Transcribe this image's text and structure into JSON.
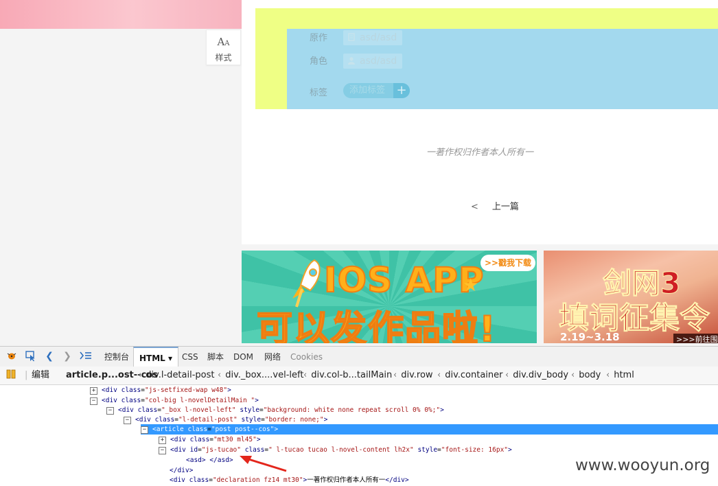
{
  "style_button": {
    "aa_big": "A",
    "aa_small": "A",
    "label": "样式"
  },
  "form": {
    "original": {
      "label": "原作",
      "value": "asd/asd"
    },
    "role": {
      "label": "角色",
      "value": "asd/asd"
    },
    "tags": {
      "label": "标签",
      "button": "添加标签",
      "plus": "+"
    }
  },
  "declaration": "一著作权归作者本人所有一",
  "nav": {
    "prev_arrow": "<",
    "prev_label": "上一篇"
  },
  "ads": {
    "ad1": {
      "title": "IOS APP",
      "subtitle": "可以发作品啦!",
      "bubble": ">>戳我下载"
    },
    "ad2": {
      "title": "剑网3",
      "subtitle": "填词征集令",
      "date": "2.19~3.18",
      "link": ">>>前往围观"
    }
  },
  "devtools": {
    "tabs": [
      "控制台",
      "HTML",
      "CSS",
      "脚本",
      "DOM",
      "网络",
      "Cookies"
    ],
    "edit_label": "编辑",
    "breadcrumbs": [
      "article.p...ost--cos",
      "div.l-detail-post",
      "div._box....vel-left",
      "div.col-b...tailMain",
      "div.row",
      "div.container",
      "div.div_body",
      "body",
      "html"
    ],
    "tree": [
      {
        "toggle": "+",
        "parts": [
          [
            "tg",
            "<div  "
          ],
          [
            "an",
            "class"
          ],
          [
            "tx",
            "="
          ],
          [
            "av",
            "\"js-setfixed-wap w48\""
          ],
          [
            "tg",
            ">"
          ]
        ]
      },
      {
        "toggle": "−",
        "parts": [
          [
            "tg",
            "<div  "
          ],
          [
            "an",
            "class"
          ],
          [
            "tx",
            "="
          ],
          [
            "av",
            "\"col-big l-novelDetailMain \""
          ],
          [
            "tg",
            ">"
          ]
        ]
      },
      {
        "toggle": "−",
        "parts": [
          [
            "tg",
            "<div  "
          ],
          [
            "an",
            "class"
          ],
          [
            "tx",
            "="
          ],
          [
            "av",
            "\"_box l-novel-left\""
          ],
          [
            "tg",
            "  "
          ],
          [
            "an",
            "style"
          ],
          [
            "tx",
            "="
          ],
          [
            "av",
            "\"background: white none repeat scroll 0% 0%;\""
          ],
          [
            "tg",
            ">"
          ]
        ]
      },
      {
        "toggle": "−",
        "parts": [
          [
            "tg",
            "<div  "
          ],
          [
            "an",
            "class"
          ],
          [
            "tx",
            "="
          ],
          [
            "av",
            "\"l-detail-post\""
          ],
          [
            "tg",
            "  "
          ],
          [
            "an",
            "style"
          ],
          [
            "tx",
            "="
          ],
          [
            "av",
            "\"border: none;\""
          ],
          [
            "tg",
            ">"
          ]
        ]
      },
      {
        "toggle": "−",
        "parts": [
          [
            "tg",
            "<article  "
          ],
          [
            "an",
            "class"
          ],
          [
            "tx",
            "="
          ],
          [
            "av",
            "\"post post--cos\""
          ],
          [
            "tg",
            ">"
          ]
        ]
      },
      {
        "toggle": "+",
        "parts": [
          [
            "tg",
            "<div  "
          ],
          [
            "an",
            "class"
          ],
          [
            "tx",
            "="
          ],
          [
            "av",
            "\"mt30 ml45\""
          ],
          [
            "tg",
            ">"
          ]
        ]
      },
      {
        "toggle": "−",
        "parts": [
          [
            "tg",
            "<div  "
          ],
          [
            "an",
            "id"
          ],
          [
            "tx",
            "="
          ],
          [
            "av",
            "\"js-tucao\""
          ],
          [
            "tg",
            "  "
          ],
          [
            "an",
            "class"
          ],
          [
            "tx",
            "="
          ],
          [
            "av",
            "\" l-tucao tucao l-novel-content lh2x\""
          ],
          [
            "tg",
            "  "
          ],
          [
            "an",
            "style"
          ],
          [
            "tx",
            "="
          ],
          [
            "av",
            "\"font-size: 16px\""
          ],
          [
            "tg",
            ">"
          ]
        ]
      },
      {
        "toggle": "",
        "parts": [
          [
            "tg",
            "<asd> </asd>"
          ]
        ]
      },
      {
        "toggle": "",
        "parts": [
          [
            "tg",
            "</div>"
          ]
        ]
      },
      {
        "toggle": "",
        "parts": [
          [
            "tg",
            "<div  "
          ],
          [
            "an",
            "class"
          ],
          [
            "tx",
            "="
          ],
          [
            "av",
            "\"declaration fz14 mt30\""
          ],
          [
            "tg",
            ">"
          ],
          [
            "tx",
            "一著作权归作者本人所有一"
          ],
          [
            "tg",
            "</div>"
          ]
        ]
      }
    ]
  },
  "watermark": "www.wooyun.org",
  "colors": {
    "yellow_highlight": "#efff85",
    "blue_highlight": "#a3d9ee",
    "selection": "#3399ff"
  }
}
